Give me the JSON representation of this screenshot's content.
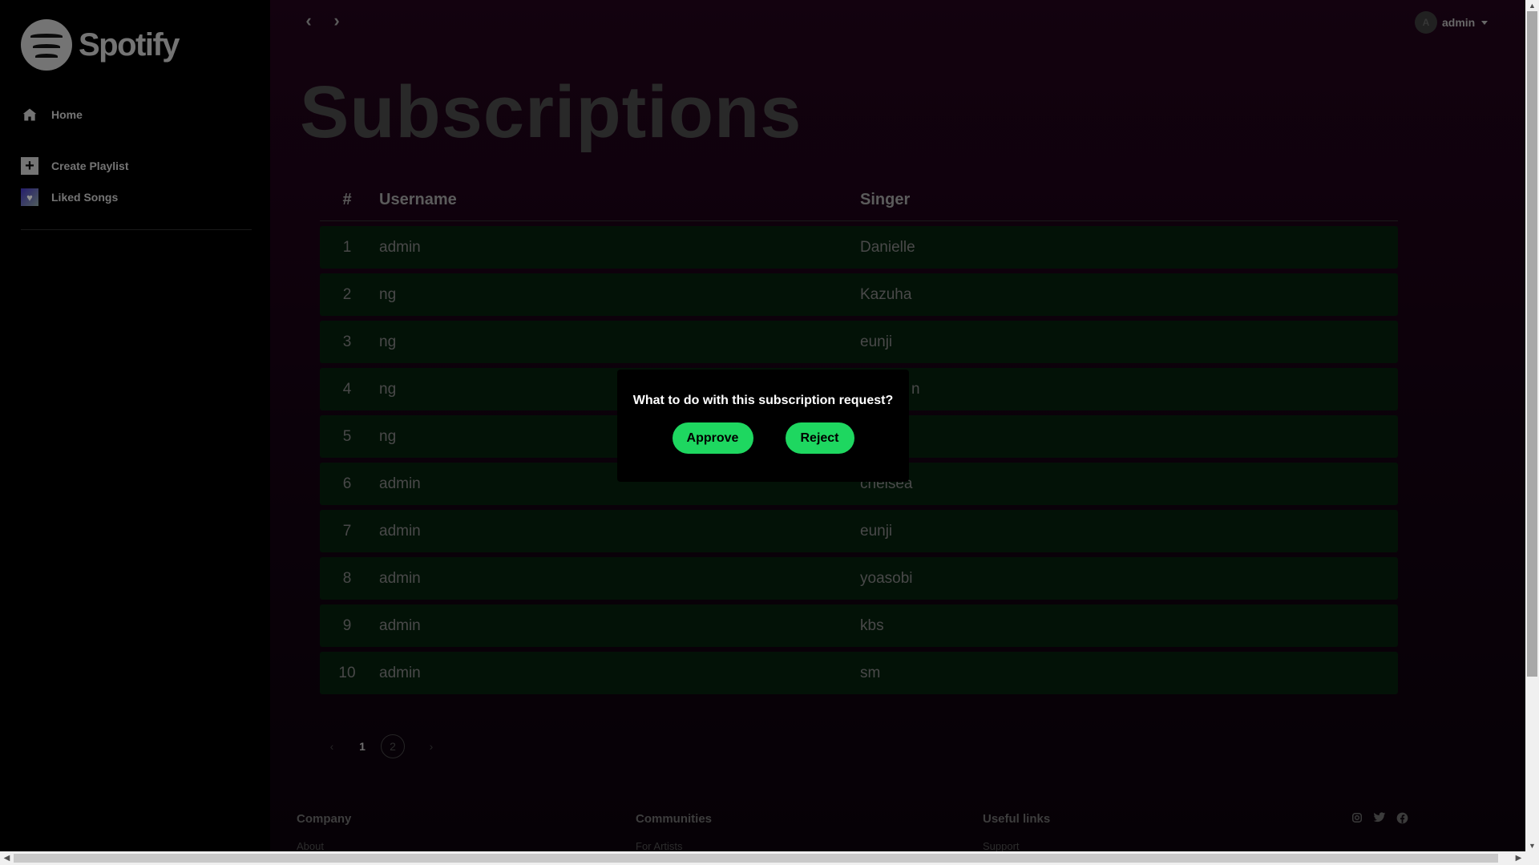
{
  "brand": {
    "name": "Spotify",
    "accent": "#1ed760"
  },
  "sidebar": {
    "items": [
      {
        "label": "Home",
        "icon": "home-icon"
      },
      {
        "label": "Create Playlist",
        "icon": "plus-icon"
      },
      {
        "label": "Liked Songs",
        "icon": "heart-icon"
      }
    ]
  },
  "topbar": {
    "back_icon": "‹",
    "forward_icon": "›",
    "user": {
      "name": "admin",
      "avatar_initial": "A"
    }
  },
  "page": {
    "title": "Subscriptions"
  },
  "table": {
    "headers": {
      "num": "#",
      "username": "Username",
      "singer": "Singer"
    },
    "rows": [
      {
        "num": "1",
        "username": "admin",
        "singer": "Danielle"
      },
      {
        "num": "2",
        "username": "ng",
        "singer": "Kazuha"
      },
      {
        "num": "3",
        "username": "ng",
        "singer": "eunji"
      },
      {
        "num": "4",
        "username": "ng",
        "singer": "n"
      },
      {
        "num": "5",
        "username": "ng",
        "singer": ""
      },
      {
        "num": "6",
        "username": "admin",
        "singer": "chelsea"
      },
      {
        "num": "7",
        "username": "admin",
        "singer": "eunji"
      },
      {
        "num": "8",
        "username": "admin",
        "singer": "yoasobi"
      },
      {
        "num": "9",
        "username": "admin",
        "singer": "kbs"
      },
      {
        "num": "10",
        "username": "admin",
        "singer": "sm"
      }
    ]
  },
  "pagination": {
    "prev": "‹",
    "next": "›",
    "current": "1",
    "other": "2"
  },
  "footer": {
    "columns": [
      {
        "heading": "Company",
        "first_link": "About"
      },
      {
        "heading": "Communities",
        "first_link": "For Artists"
      },
      {
        "heading": "Useful links",
        "first_link": "Support"
      }
    ],
    "social": [
      "instagram-icon",
      "twitter-icon",
      "facebook-icon"
    ]
  },
  "modal": {
    "title": "What to do with this subscription request?",
    "approve_label": "Approve",
    "reject_label": "Reject"
  }
}
